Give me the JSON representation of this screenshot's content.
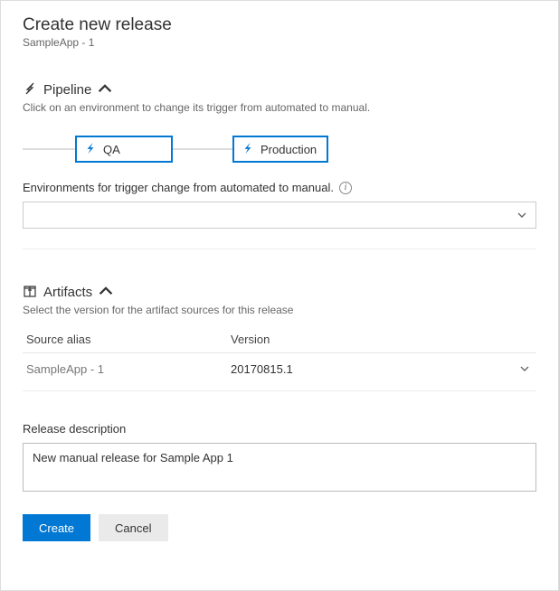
{
  "header": {
    "title": "Create new release",
    "subtitle": "SampleApp - 1"
  },
  "pipeline": {
    "section_label": "Pipeline",
    "description": "Click on an environment to change its trigger from automated to manual.",
    "stages": {
      "qa": "QA",
      "production": "Production"
    }
  },
  "environments": {
    "label": "Environments for trigger change from automated to manual.",
    "selected": ""
  },
  "artifacts": {
    "section_label": "Artifacts",
    "description": "Select the version for the artifact sources for this release",
    "columns": {
      "source": "Source alias",
      "version": "Version"
    },
    "rows": [
      {
        "source": "SampleApp - 1",
        "version": "20170815.1"
      }
    ]
  },
  "description": {
    "label": "Release description",
    "value": "New manual release for Sample App 1"
  },
  "buttons": {
    "create": "Create",
    "cancel": "Cancel"
  }
}
